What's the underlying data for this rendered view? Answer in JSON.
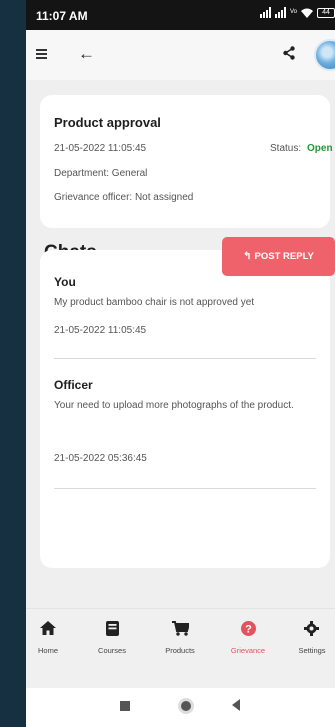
{
  "statusbar": {
    "time": "11:07 AM",
    "battery": "44",
    "network": "Vo LTE"
  },
  "grievance": {
    "title": "Product approval",
    "date": "21-05-2022 11:05:45",
    "status_label": "Status:",
    "status_value": "Open",
    "department": "Department: General",
    "officer": "Grievance officer: Not assigned"
  },
  "chats": {
    "heading": "Chats",
    "reply_button": "POST REPLY",
    "messages": [
      {
        "sender": "You",
        "text": "My product bamboo chair is not approved yet",
        "time": "21-05-2022 11:05:45"
      },
      {
        "sender": "Officer",
        "text": "Your need to upload more photographs of the product.",
        "time": "21-05-2022 05:36:45"
      }
    ]
  },
  "bottom_nav": [
    {
      "label": "Home",
      "icon": "home-icon"
    },
    {
      "label": "Courses",
      "icon": "book-icon"
    },
    {
      "label": "Products",
      "icon": "cart-icon"
    },
    {
      "label": "Grievance",
      "icon": "question-circle-icon",
      "active": true
    },
    {
      "label": "Settings",
      "icon": "gear-icon"
    }
  ],
  "colors": {
    "accent": "#f0626b",
    "status_open": "#1e9a36",
    "background": "#173041"
  }
}
